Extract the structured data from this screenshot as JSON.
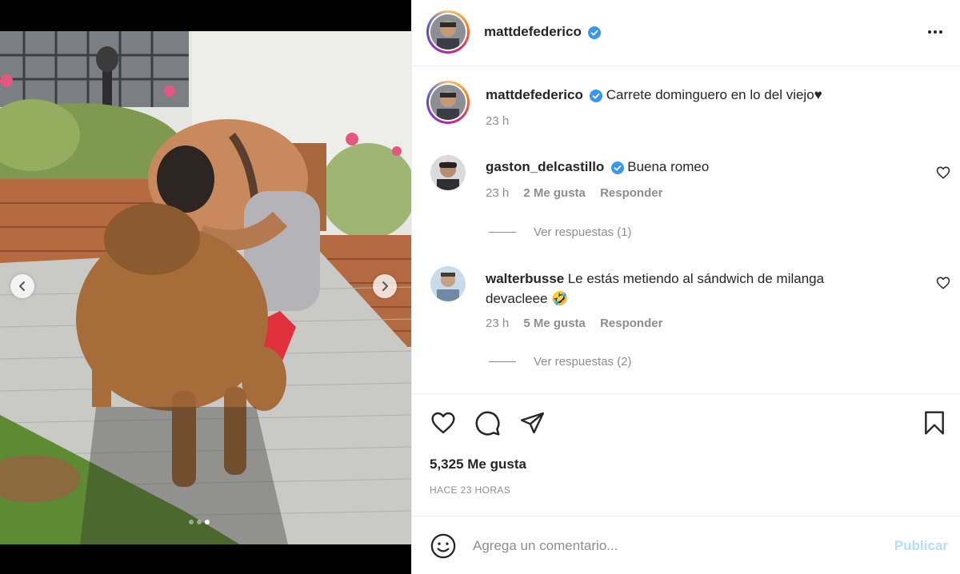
{
  "post": {
    "author": "mattdefederico",
    "verified": true,
    "caption": "Carrete dominguero en lo del viejo♥",
    "caption_time": "23 h",
    "carousel": {
      "total": 3,
      "active_index": 2
    }
  },
  "comments": [
    {
      "user": "gaston_delcastillo",
      "verified": true,
      "text": "Buena romeo",
      "time": "23 h",
      "likes": "2 Me gusta",
      "reply_label": "Responder",
      "view_replies": "Ver respuestas (1)"
    },
    {
      "user": "walterbusse",
      "verified": false,
      "text": "Le estás metiendo al sándwich de milanga",
      "text_line2": "devacleee 🤣",
      "time": "23 h",
      "likes": "5 Me gusta",
      "reply_label": "Responder",
      "view_replies": "Ver respuestas (2)"
    }
  ],
  "stats": {
    "likes": "5,325 Me gusta",
    "time_ago": "HACE 23 HORAS"
  },
  "comment_box": {
    "placeholder": "Agrega un comentario...",
    "publish_label": "Publicar"
  },
  "icons": [
    "more-options-icon",
    "verified-badge-icon",
    "heart-icon",
    "comment-icon",
    "share-icon",
    "bookmark-icon",
    "emoji-icon",
    "chevron-left-icon",
    "chevron-right-icon"
  ],
  "colors": {
    "verified_blue": "#3897f0",
    "publish_disabled": "#b2dffc",
    "muted_text": "#8e8e8e"
  }
}
